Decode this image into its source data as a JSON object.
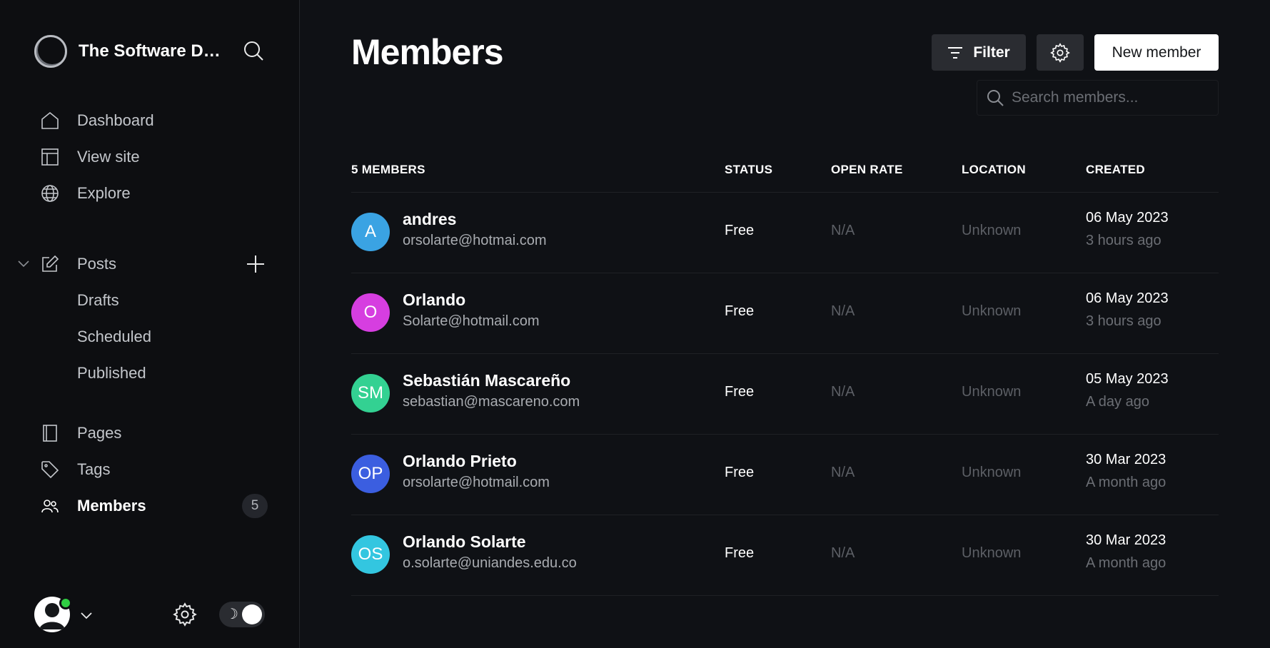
{
  "sidebar": {
    "site_name": "The Software De...",
    "items": [
      {
        "label": "Dashboard",
        "icon": "home-icon"
      },
      {
        "label": "View site",
        "icon": "layout-icon"
      },
      {
        "label": "Explore",
        "icon": "globe-icon"
      },
      {
        "label": "Posts",
        "icon": "edit-icon"
      },
      {
        "label": "Drafts"
      },
      {
        "label": "Scheduled"
      },
      {
        "label": "Published"
      },
      {
        "label": "Pages",
        "icon": "page-icon"
      },
      {
        "label": "Tags",
        "icon": "tag-icon"
      },
      {
        "label": "Members",
        "icon": "users-icon",
        "active": true
      }
    ],
    "members_count": "5",
    "theme_icon": "☽"
  },
  "header": {
    "title": "Members",
    "filter_label": "Filter",
    "new_member_label": "New member",
    "search_placeholder": "Search members..."
  },
  "table": {
    "columns": [
      "5 MEMBERS",
      "STATUS",
      "OPEN RATE",
      "LOCATION",
      "CREATED"
    ],
    "rows": [
      {
        "initials": "A",
        "color": "#3aa3e3",
        "name": "andres",
        "email": "orsolarte@hotmai.com",
        "status": "Free",
        "open_rate": "N/A",
        "location": "Unknown",
        "created": "06 May 2023",
        "ago": "3 hours ago"
      },
      {
        "initials": "O",
        "color": "#d63ee0",
        "name": "Orlando",
        "email": "Solarte@hotmail.com",
        "status": "Free",
        "open_rate": "N/A",
        "location": "Unknown",
        "created": "06 May 2023",
        "ago": "3 hours ago"
      },
      {
        "initials": "SM",
        "color": "#33d192",
        "name": "Sebastián Mascareño",
        "email": "sebastian@mascareno.com",
        "status": "Free",
        "open_rate": "N/A",
        "location": "Unknown",
        "created": "05 May 2023",
        "ago": "A day ago"
      },
      {
        "initials": "OP",
        "color": "#3b5ee0",
        "name": "Orlando Prieto",
        "email": "orsolarte@hotmail.com",
        "status": "Free",
        "open_rate": "N/A",
        "location": "Unknown",
        "created": "30 Mar 2023",
        "ago": "A month ago"
      },
      {
        "initials": "OS",
        "color": "#33c6e0",
        "name": "Orlando Solarte",
        "email": "o.solarte@uniandes.edu.co",
        "status": "Free",
        "open_rate": "N/A",
        "location": "Unknown",
        "created": "30 Mar 2023",
        "ago": "A month ago"
      }
    ]
  }
}
